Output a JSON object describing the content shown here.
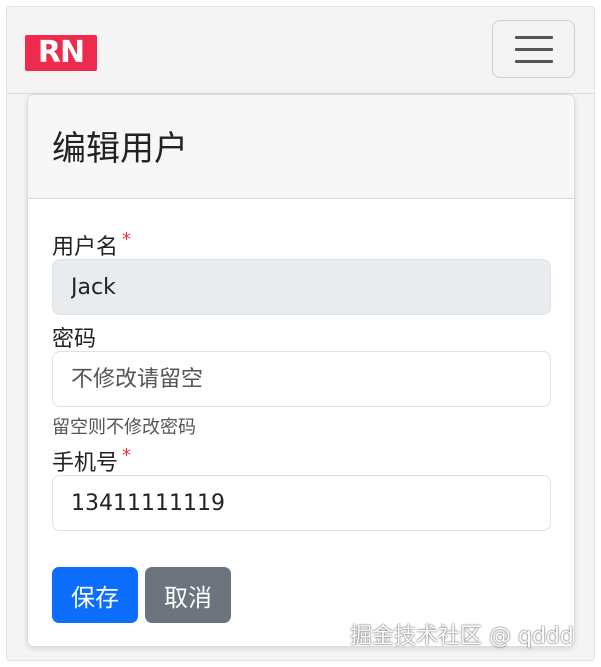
{
  "navbar": {
    "logo_text": "RN",
    "toggler_icon": "hamburger-menu-icon"
  },
  "card": {
    "title": "编辑用户"
  },
  "form": {
    "username": {
      "label": "用户名",
      "required_mark": "*",
      "value": "Jack"
    },
    "password": {
      "label": "密码",
      "placeholder": "不修改请留空",
      "help": "留空则不修改密码"
    },
    "phone": {
      "label": "手机号",
      "required_mark": "*",
      "value": "13411111119"
    },
    "save_label": "保存",
    "cancel_label": "取消"
  },
  "watermark": "掘金技术社区 @ qddd",
  "colors": {
    "primary": "#0d6efd",
    "secondary": "#6c757d",
    "required": "#dc3545",
    "logo_bg": "#ee2a4d"
  }
}
